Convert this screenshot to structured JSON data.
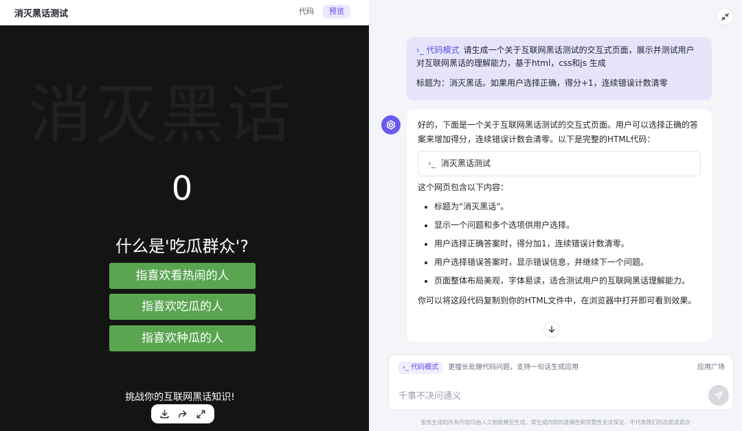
{
  "preview_header": {
    "title": "消灭黑话测试",
    "tabs": [
      {
        "label": "代码",
        "active": false
      },
      {
        "label": "预览",
        "active": true
      }
    ]
  },
  "game": {
    "watermark": "消灭黑话",
    "score": "0",
    "question": "什么是'吃瓜群众'?",
    "options": [
      "指喜欢看热闹的人",
      "指喜欢吃瓜的人",
      "指喜欢种瓜的人"
    ],
    "footer": "挑战你的互联网黑话知识!",
    "option_color": "#5aa550",
    "background_color": "#141414"
  },
  "toolbar": {
    "icons": [
      "download-icon",
      "share-icon",
      "fullscreen-icon"
    ]
  },
  "chat": {
    "user_message": {
      "mode_tag": "›_ 代码模式",
      "text": "请生成一个关于互联网黑话测试的交互式页面，展示并测试用户对互联网黑话的理解能力，基于html，css和js 生成",
      "text2": "标题为：消灭黑话。如果用户选择正确，得分+1，连续错误计数清零"
    },
    "bot_message": {
      "intro": "好的，下面是一个关于互联网黑话测试的交互式页面。用户可以选择正确的答案来增加得分，连续错误计数会清零。以下是完整的HTML代码：",
      "code_card_prompt": "›_",
      "code_card_label": "消灭黑话测试",
      "intro2": "这个网页包含以下内容：",
      "bullets": [
        "标题为“消灭黑话”。",
        "显示一个问题和多个选项供用户选择。",
        "用户选择正确答案时，得分加1，连续错误计数清零。",
        "用户选择错误答案时，显示错误信息，并继续下一个问题。",
        "页面整体布局美观，字体易读，适合测试用户的互联网黑话理解能力。"
      ],
      "outro": "你可以将这段代码复制到你的HTML文件中，在浏览器中打开即可看到效果。"
    }
  },
  "composer": {
    "mode_chip": "›_ 代码模式",
    "mode_hint": "更擅长处理代码问题，支持一句话生成应用",
    "app_plaza": "应用广场",
    "placeholder": "千事不决问通义"
  },
  "disclaimer": "服务生成的所有内容均由人工智能模型生成，其生成内容的准确性和完整性无法保证，不代表我们的态度或观点",
  "colors": {
    "accent": "#5b4ae8",
    "user_bubble": "#e6e4fb"
  }
}
